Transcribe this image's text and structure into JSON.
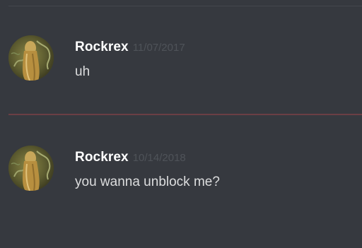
{
  "messages": [
    {
      "author": "Rockrex",
      "timestamp": "11/07/2017",
      "content": "uh",
      "avatar_icon": "user-avatar-icon"
    },
    {
      "author": "Rockrex",
      "timestamp": "10/14/2018",
      "content": "you wanna unblock me?",
      "avatar_icon": "user-avatar-icon"
    }
  ],
  "colors": {
    "background": "#36393f",
    "username": "#ffffff",
    "timestamp": "#4f5359",
    "message_text": "#dcddde",
    "new_messages_divider": "#6b3f45"
  }
}
